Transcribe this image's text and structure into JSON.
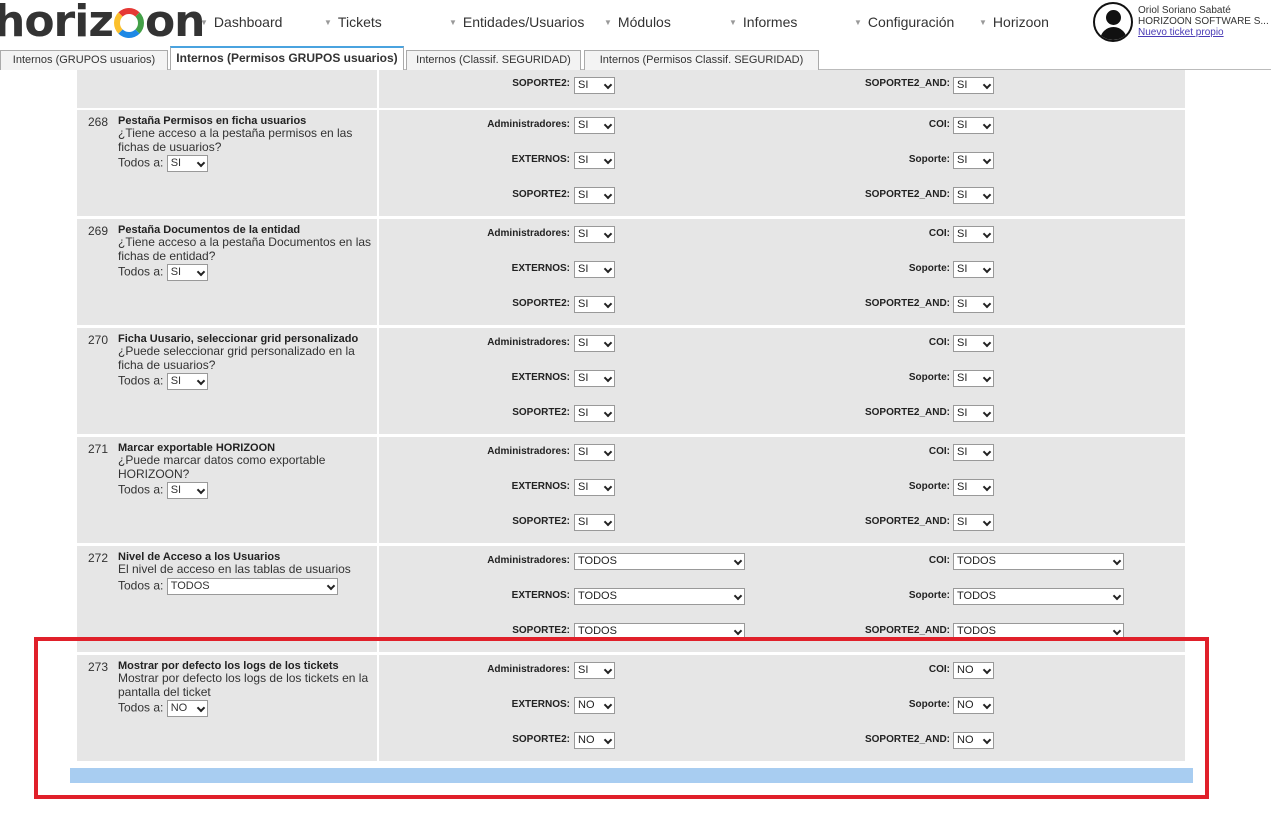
{
  "header": {
    "logo_text": "horizoon",
    "nav": [
      {
        "label": "Dashboard"
      },
      {
        "label": "Tickets"
      },
      {
        "label": "Entidades/Usuarios"
      },
      {
        "label": "Módulos"
      },
      {
        "label": "Informes"
      },
      {
        "label": "Configuración"
      },
      {
        "label": "Horizoon"
      }
    ],
    "user": {
      "name": "Oriol Soriano Sabaté",
      "company": "HORIZOON SOFTWARE S...",
      "link": "Nuevo ticket propio"
    }
  },
  "tabs": [
    {
      "label": "Internos (GRUPOS usuarios)",
      "active": false
    },
    {
      "label": "Internos (Permisos GRUPOS usuarios)",
      "active": true
    },
    {
      "label": "Internos (Classif. SEGURIDAD)",
      "active": false
    },
    {
      "label": "Internos (Permisos Classif. SEGURIDAD)",
      "active": false
    }
  ],
  "common": {
    "todos_label": "Todos a:",
    "admin_label": "Administradores:",
    "coi_label": "COI:",
    "externos_label": "EXTERNOS:",
    "soporte_label": "Soporte:",
    "soporte2_label": "SOPORTE2:",
    "soporte2and_label": "SOPORTE2_AND:"
  },
  "partial_row": {
    "soporte2": "SI",
    "soporte2_and": "SI"
  },
  "rows": [
    {
      "num": "268",
      "title": "Pestaña Permisos en ficha usuarios",
      "desc": "¿Tiene acceso a la pestaña permisos en las fichas de usuarios?",
      "todos": "SI",
      "admin": "SI",
      "coi": "SI",
      "externos": "SI",
      "soporte": "SI",
      "soporte2": "SI",
      "soporte2_and": "SI"
    },
    {
      "num": "269",
      "title": "Pestaña Documentos de la entidad",
      "desc": "¿Tiene acceso a la pestaña Documentos en las fichas de entidad?",
      "todos": "SI",
      "admin": "SI",
      "coi": "SI",
      "externos": "SI",
      "soporte": "SI",
      "soporte2": "SI",
      "soporte2_and": "SI"
    },
    {
      "num": "270",
      "title": "Ficha Uusario, seleccionar grid personalizado",
      "desc": "¿Puede seleccionar grid personalizado en la ficha de usuarios?",
      "todos": "SI",
      "admin": "SI",
      "coi": "SI",
      "externos": "SI",
      "soporte": "SI",
      "soporte2": "SI",
      "soporte2_and": "SI"
    },
    {
      "num": "271",
      "title": "Marcar exportable HORIZOON",
      "desc": "¿Puede marcar datos como exportable HORIZOON?",
      "todos": "SI",
      "admin": "SI",
      "coi": "SI",
      "externos": "SI",
      "soporte": "SI",
      "soporte2": "SI",
      "soporte2_and": "SI"
    },
    {
      "num": "272",
      "title": "Nivel de Acceso a los Usuarios",
      "desc": "El nivel de acceso en las tablas de usuarios",
      "todos": "TODOS",
      "admin": "TODOS",
      "coi": "TODOS",
      "externos": "TODOS",
      "soporte": "TODOS",
      "soporte2": "TODOS",
      "soporte2_and": "TODOS"
    },
    {
      "num": "273",
      "title": "Mostrar por defecto los logs de los tickets",
      "desc": "Mostrar por defecto los logs de los tickets en la pantalla del ticket",
      "todos": "NO",
      "admin": "SI",
      "coi": "NO",
      "externos": "NO",
      "soporte": "NO",
      "soporte2": "NO",
      "soporte2_and": "NO"
    }
  ]
}
